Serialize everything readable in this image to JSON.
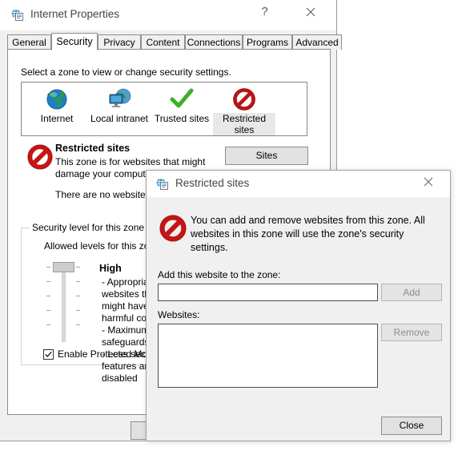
{
  "main_window": {
    "title": "Internet Properties",
    "title_icon": "internet-properties-icon",
    "help_button": "?",
    "close_button": "close-icon",
    "tabs": [
      {
        "label": "General",
        "active": false
      },
      {
        "label": "Security",
        "active": true
      },
      {
        "label": "Privacy",
        "active": false
      },
      {
        "label": "Content",
        "active": false
      },
      {
        "label": "Connections",
        "active": false
      },
      {
        "label": "Programs",
        "active": false
      },
      {
        "label": "Advanced",
        "active": false
      }
    ],
    "security_tab": {
      "zone_prompt": "Select a zone to view or change security settings.",
      "zones": [
        {
          "label": "Internet",
          "icon": "globe-icon",
          "selected": false
        },
        {
          "label": "Local intranet",
          "icon": "computer-network-icon",
          "selected": false
        },
        {
          "label": "Trusted sites",
          "icon": "green-check-icon",
          "selected": false
        },
        {
          "label": "Restricted sites",
          "icon": "red-prohibition-icon",
          "selected": true
        }
      ],
      "zone_detail": {
        "icon": "red-prohibition-icon",
        "title": "Restricted sites",
        "description": "This zone is for websites that might damage your computer or your files.",
        "note": "There are no websites in this zone.",
        "sites_button": "Sites"
      },
      "security_level": {
        "group_title": "Security level for this zone",
        "allowed_label": "Allowed levels for this zone:",
        "level_name": "High",
        "bullets": [
          "- Appropriate for websites that might have harmful content",
          "- Maximum safeguards",
          "- Less secure features are disabled"
        ],
        "protected_mode": {
          "label": "Enable Protected Mode (requires restarting Internet Explorer)",
          "checked": true
        }
      }
    }
  },
  "modal": {
    "title": "Restricted sites",
    "title_icon": "internet-properties-icon",
    "close_button": "close-icon",
    "banner_icon": "red-prohibition-icon",
    "banner_text": "You can add and remove websites from this zone. All websites in this zone will use the zone's security settings.",
    "add_label": "Add this website to the zone:",
    "add_input_value": "",
    "add_input_placeholder": "",
    "add_button": "Add",
    "add_button_disabled": true,
    "websites_label": "Websites:",
    "websites_items": [],
    "remove_button": "Remove",
    "remove_button_disabled": true,
    "close_label": "Close"
  },
  "colors": {
    "window_bg": "#f0f0f0",
    "titlebar_bg": "#ffffff",
    "page_bg": "#ffffff",
    "button_face": "#e1e1e1",
    "border": "#8d8d8d",
    "text": "#000000",
    "title_text": "#444444",
    "disabled_text": "#8d8d8d",
    "selected_highlight": "#e8e8e8",
    "accent_red": "#cc1111",
    "accent_green": "#3fae2a",
    "accent_blue": "#1e86c8"
  }
}
